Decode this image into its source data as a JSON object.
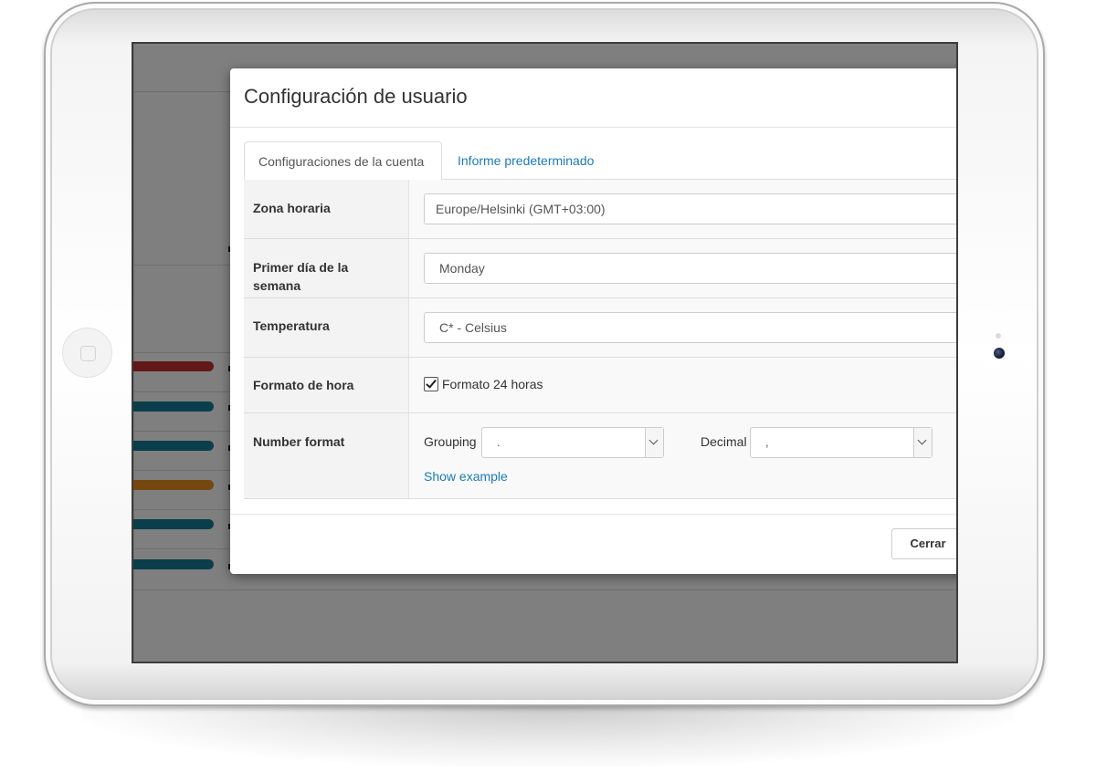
{
  "modal": {
    "title": "Configuración de usuario",
    "tabs": [
      {
        "label": "Configuraciones de la cuenta",
        "active": true
      },
      {
        "label": "Informe predeterminado",
        "active": false
      }
    ],
    "fields": {
      "timezone": {
        "label": "Zona horaria",
        "value": "Europe/Helsinki (GMT+03:00)"
      },
      "first_day": {
        "label": "Primer día de la semana",
        "value": "Monday"
      },
      "temperature": {
        "label": "Temperatura",
        "value": "C* - Celsius"
      },
      "time_format": {
        "label": "Formato de hora",
        "checkbox_label": "Formato 24 horas",
        "checked": true
      },
      "number_format": {
        "label": "Number format",
        "grouping_label": "Grouping",
        "grouping_value": ".",
        "decimal_label": "Decimal",
        "decimal_value": ",",
        "show_example": "Show example"
      }
    },
    "close_label": "Cerrar"
  },
  "colors": {
    "link": "#1a7bb9",
    "bar_red": "#c2312e",
    "bar_teal": "#157d95",
    "bar_orange": "#e89020"
  }
}
